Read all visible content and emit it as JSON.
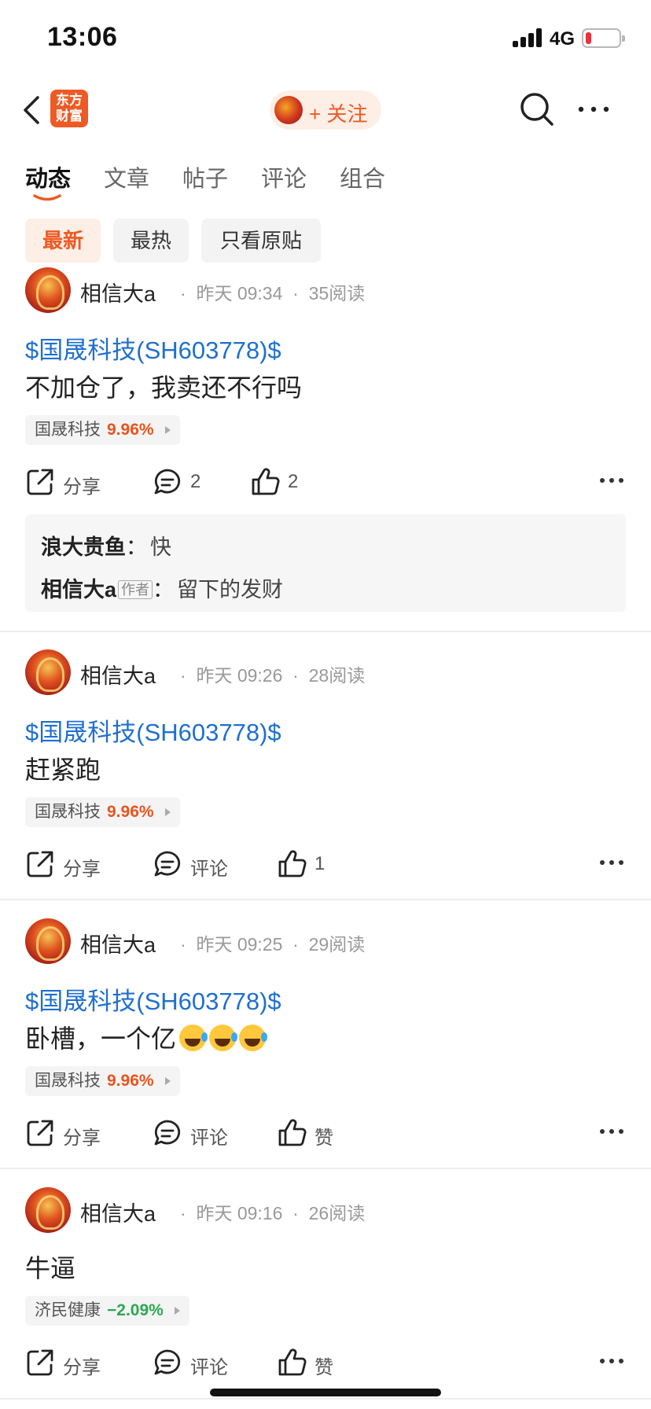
{
  "status_bar": {
    "time": "13:06",
    "network": "4G"
  },
  "nav": {
    "logo_line1": "东方",
    "logo_line2": "财富",
    "follow_label": "+ 关注"
  },
  "tabs": [
    "动态",
    "文章",
    "帖子",
    "评论",
    "组合"
  ],
  "filters": [
    "最新",
    "最热",
    "只看原贴"
  ],
  "posts": [
    {
      "username": "相信大a",
      "meta": "·  昨天 09:34  ·  35阅读",
      "stock_link": "$国晟科技(SH603778)$",
      "text": "不加仓了，我卖还不行吗",
      "tag_name": "国晟科技",
      "tag_pct": "9.96%",
      "share": "分享",
      "comment": "2",
      "like": "2",
      "comments": [
        {
          "name": "浪大贵鱼",
          "sep": "：",
          "text": "快"
        },
        {
          "name": "相信大a",
          "badge": "作者",
          "sep": "：",
          "text": "留下的发财"
        }
      ]
    },
    {
      "username": "相信大a",
      "meta": "·  昨天 09:26  ·  28阅读",
      "stock_link": "$国晟科技(SH603778)$",
      "text": "赶紧跑",
      "tag_name": "国晟科技",
      "tag_pct": "9.96%",
      "share": "分享",
      "comment": "评论",
      "like": "1"
    },
    {
      "username": "相信大a",
      "meta": "·  昨天 09:25  ·  29阅读",
      "stock_link": "$国晟科技(SH603778)$",
      "text": "卧槽，一个亿",
      "tag_name": "国晟科技",
      "tag_pct": "9.96%",
      "share": "分享",
      "comment": "评论",
      "like": "赞"
    },
    {
      "username": "相信大a",
      "meta": "·  昨天 09:16  ·  26阅读",
      "text": "牛逼",
      "tag_name": "济民健康",
      "tag_pct": "−2.09%",
      "share": "分享",
      "comment": "评论",
      "like": "赞"
    }
  ],
  "colors": {
    "accent": "#ee5a24",
    "link": "#1f6fd1",
    "up": "#e8541e",
    "down": "#2aa952"
  }
}
